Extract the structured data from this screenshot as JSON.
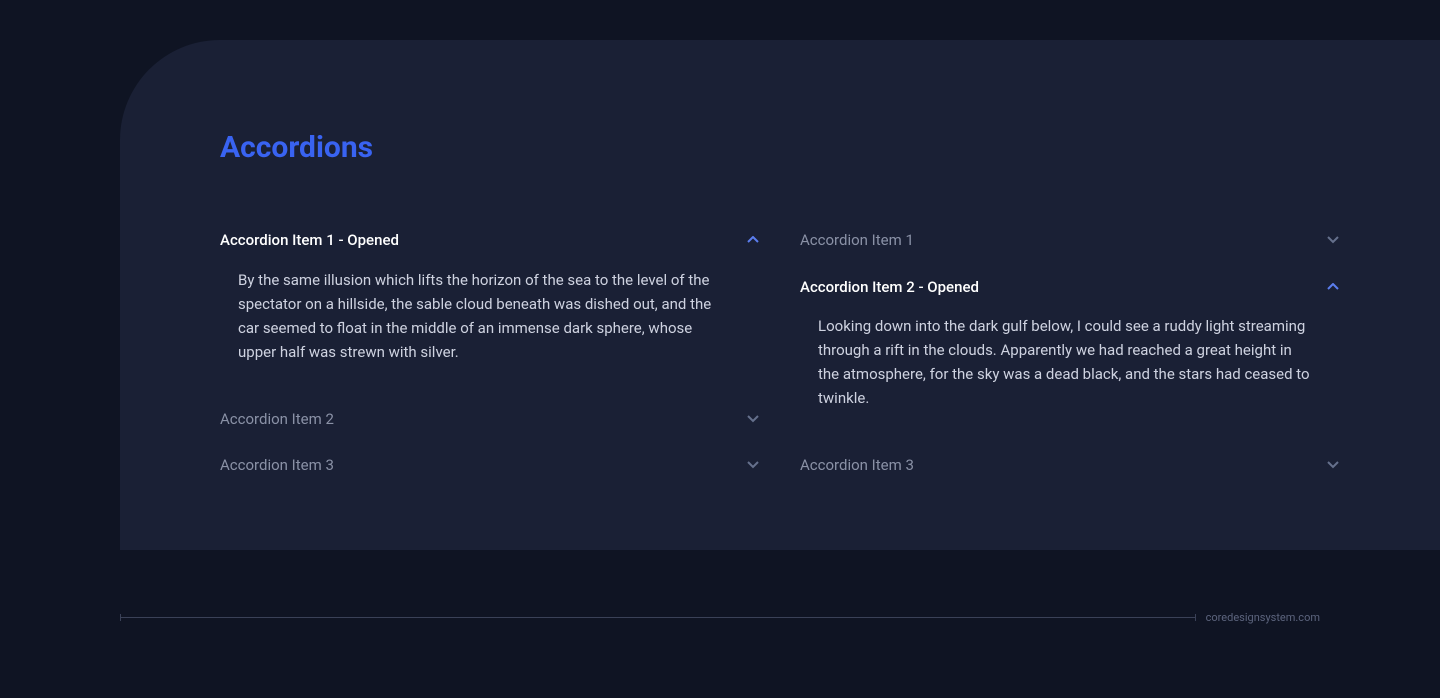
{
  "heading": "Accordions",
  "col1": {
    "item1": {
      "label": "Accordion Item 1 - Opened",
      "body": "By the same illusion which lifts the horizon of the sea to the level of the spectator on a hillside, the sable cloud beneath was dished out, and the car seemed to float in the middle of an immense dark sphere, whose upper half was strewn with silver."
    },
    "item2": {
      "label": "Accordion Item 2"
    },
    "item3": {
      "label": "Accordion Item 3"
    }
  },
  "col2": {
    "item1": {
      "label": "Accordion Item 1"
    },
    "item2": {
      "label": "Accordion Item 2 - Opened",
      "body": "Looking down into the dark gulf below, I could see a ruddy light streaming through a rift in the clouds. Apparently we had reached a great height in the atmosphere, for the sky was a dead black, and the stars had ceased to twinkle."
    },
    "item3": {
      "label": "Accordion Item 3"
    }
  },
  "footer": "coredesignsystem.com"
}
